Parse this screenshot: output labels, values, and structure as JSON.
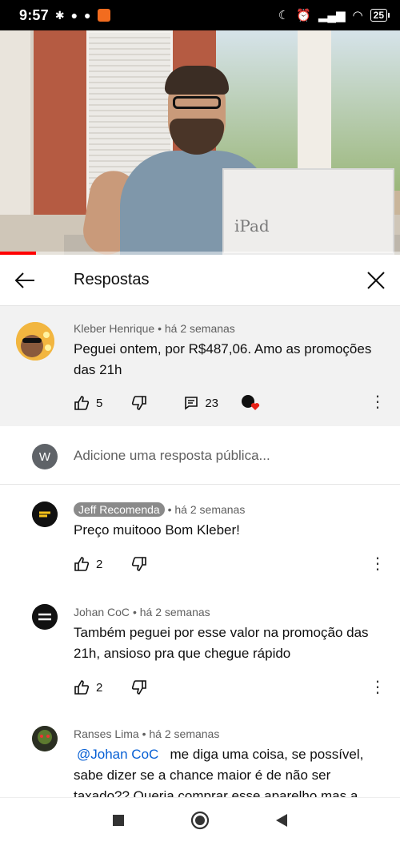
{
  "status_bar": {
    "time": "9:57",
    "battery": "25"
  },
  "video": {
    "box_label": "iPad",
    "progress": 0.09
  },
  "panel": {
    "title": "Respostas"
  },
  "parent_comment": {
    "author": "Kleber Henrique",
    "time": "há 2 semanas",
    "text": "Peguei ontem, por R$487,06. Amo as promoções das 21h",
    "likes": "5",
    "replies": "23"
  },
  "add_reply": {
    "avatar_letter": "W",
    "placeholder": "Adicione uma resposta pública..."
  },
  "replies": [
    {
      "author": "Jeff Recomenda",
      "time": "há 2 semanas",
      "text": "Preço muitooo Bom Kleber!",
      "likes": "2"
    },
    {
      "author": "Johan CoC",
      "time": "há 2 semanas",
      "text": "Também peguei por esse valor na promoção das 21h, ansioso pra que chegue rápido",
      "likes": "2"
    },
    {
      "author": "Ranses Lima",
      "time": "há 2 semanas",
      "mention": "@Johan CoC",
      "text": "me diga uma coisa, se possível, sabe dizer se  a chance maior é de não ser taxado?? Queria comprar esse aparelho mas a"
    }
  ],
  "colors": {
    "accent_red": "#ff0000",
    "mention_blue": "#065fd4",
    "parent_bg": "#f2f2f2"
  }
}
